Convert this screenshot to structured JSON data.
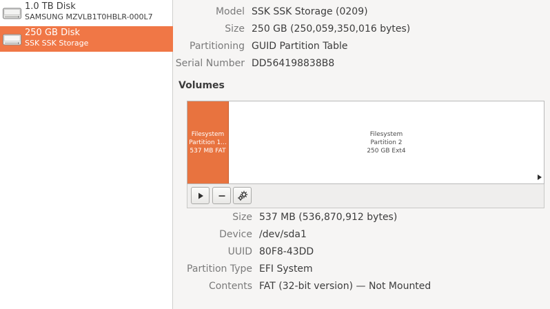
{
  "sidebar": {
    "disks": [
      {
        "name": "1.0 TB Disk",
        "subtitle": "SAMSUNG MZVLB1T0HBLR-000L7",
        "icon": "harddisk-icon",
        "selected": false
      },
      {
        "name": "250 GB Disk",
        "subtitle": "SSK SSK Storage",
        "icon": "harddisk-icon",
        "selected": true
      }
    ]
  },
  "drive": {
    "model_label": "Model",
    "model": "SSK SSK Storage (0209)",
    "size_label": "Size",
    "size": "250 GB (250,059,350,016 bytes)",
    "partitioning_label": "Partitioning",
    "partitioning": "GUID Partition Table",
    "serial_label": "Serial Number",
    "serial": "DD564198838B8"
  },
  "volumes": {
    "title": "Volumes",
    "partitions": [
      {
        "line1": "Filesystem",
        "line2": "Partition 1...",
        "line3": "537 MB FAT"
      },
      {
        "line1": "Filesystem",
        "line2": "Partition 2",
        "line3": "250 GB Ext4"
      }
    ],
    "toolbar": {
      "play_icon": "play-icon",
      "minus_icon": "minus-icon",
      "gear_icon": "gears-icon"
    }
  },
  "partition_info": {
    "size_label": "Size",
    "size": "537 MB (536,870,912 bytes)",
    "device_label": "Device",
    "device": "/dev/sda1",
    "uuid_label": "UUID",
    "uuid": "80F8-43DD",
    "type_label": "Partition Type",
    "type": "EFI System",
    "contents_label": "Contents",
    "contents": "FAT (32-bit version) — Not Mounted"
  },
  "colors": {
    "accent": "#f07746",
    "partition_selected": "#e8733f"
  }
}
